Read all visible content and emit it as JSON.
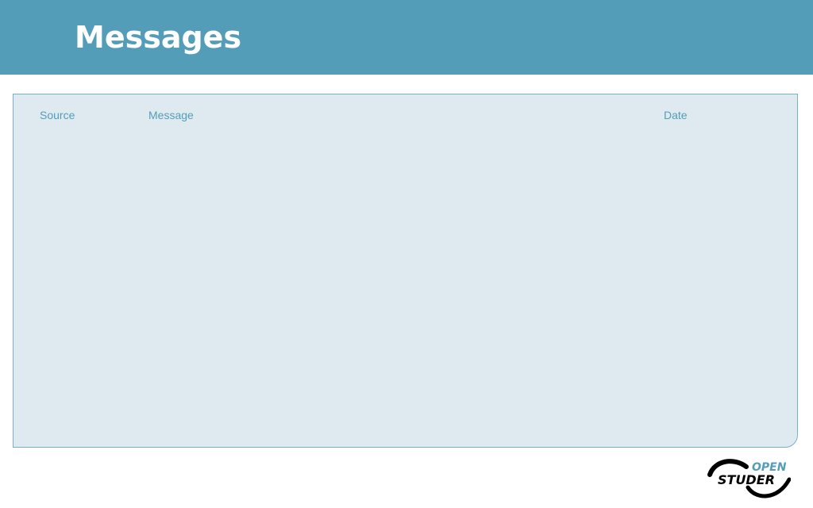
{
  "header": {
    "title": "Messages"
  },
  "table": {
    "columns": [
      "Source",
      "Message",
      "Date"
    ],
    "rows": []
  },
  "logo": {
    "top_text": "OPEN",
    "bottom_text": "STUDER"
  },
  "colors": {
    "header_bg": "#549db8",
    "panel_bg": "#deeaf0",
    "panel_border": "#79b0c8",
    "accent": "#549db8",
    "logo_dark": "#000000"
  }
}
